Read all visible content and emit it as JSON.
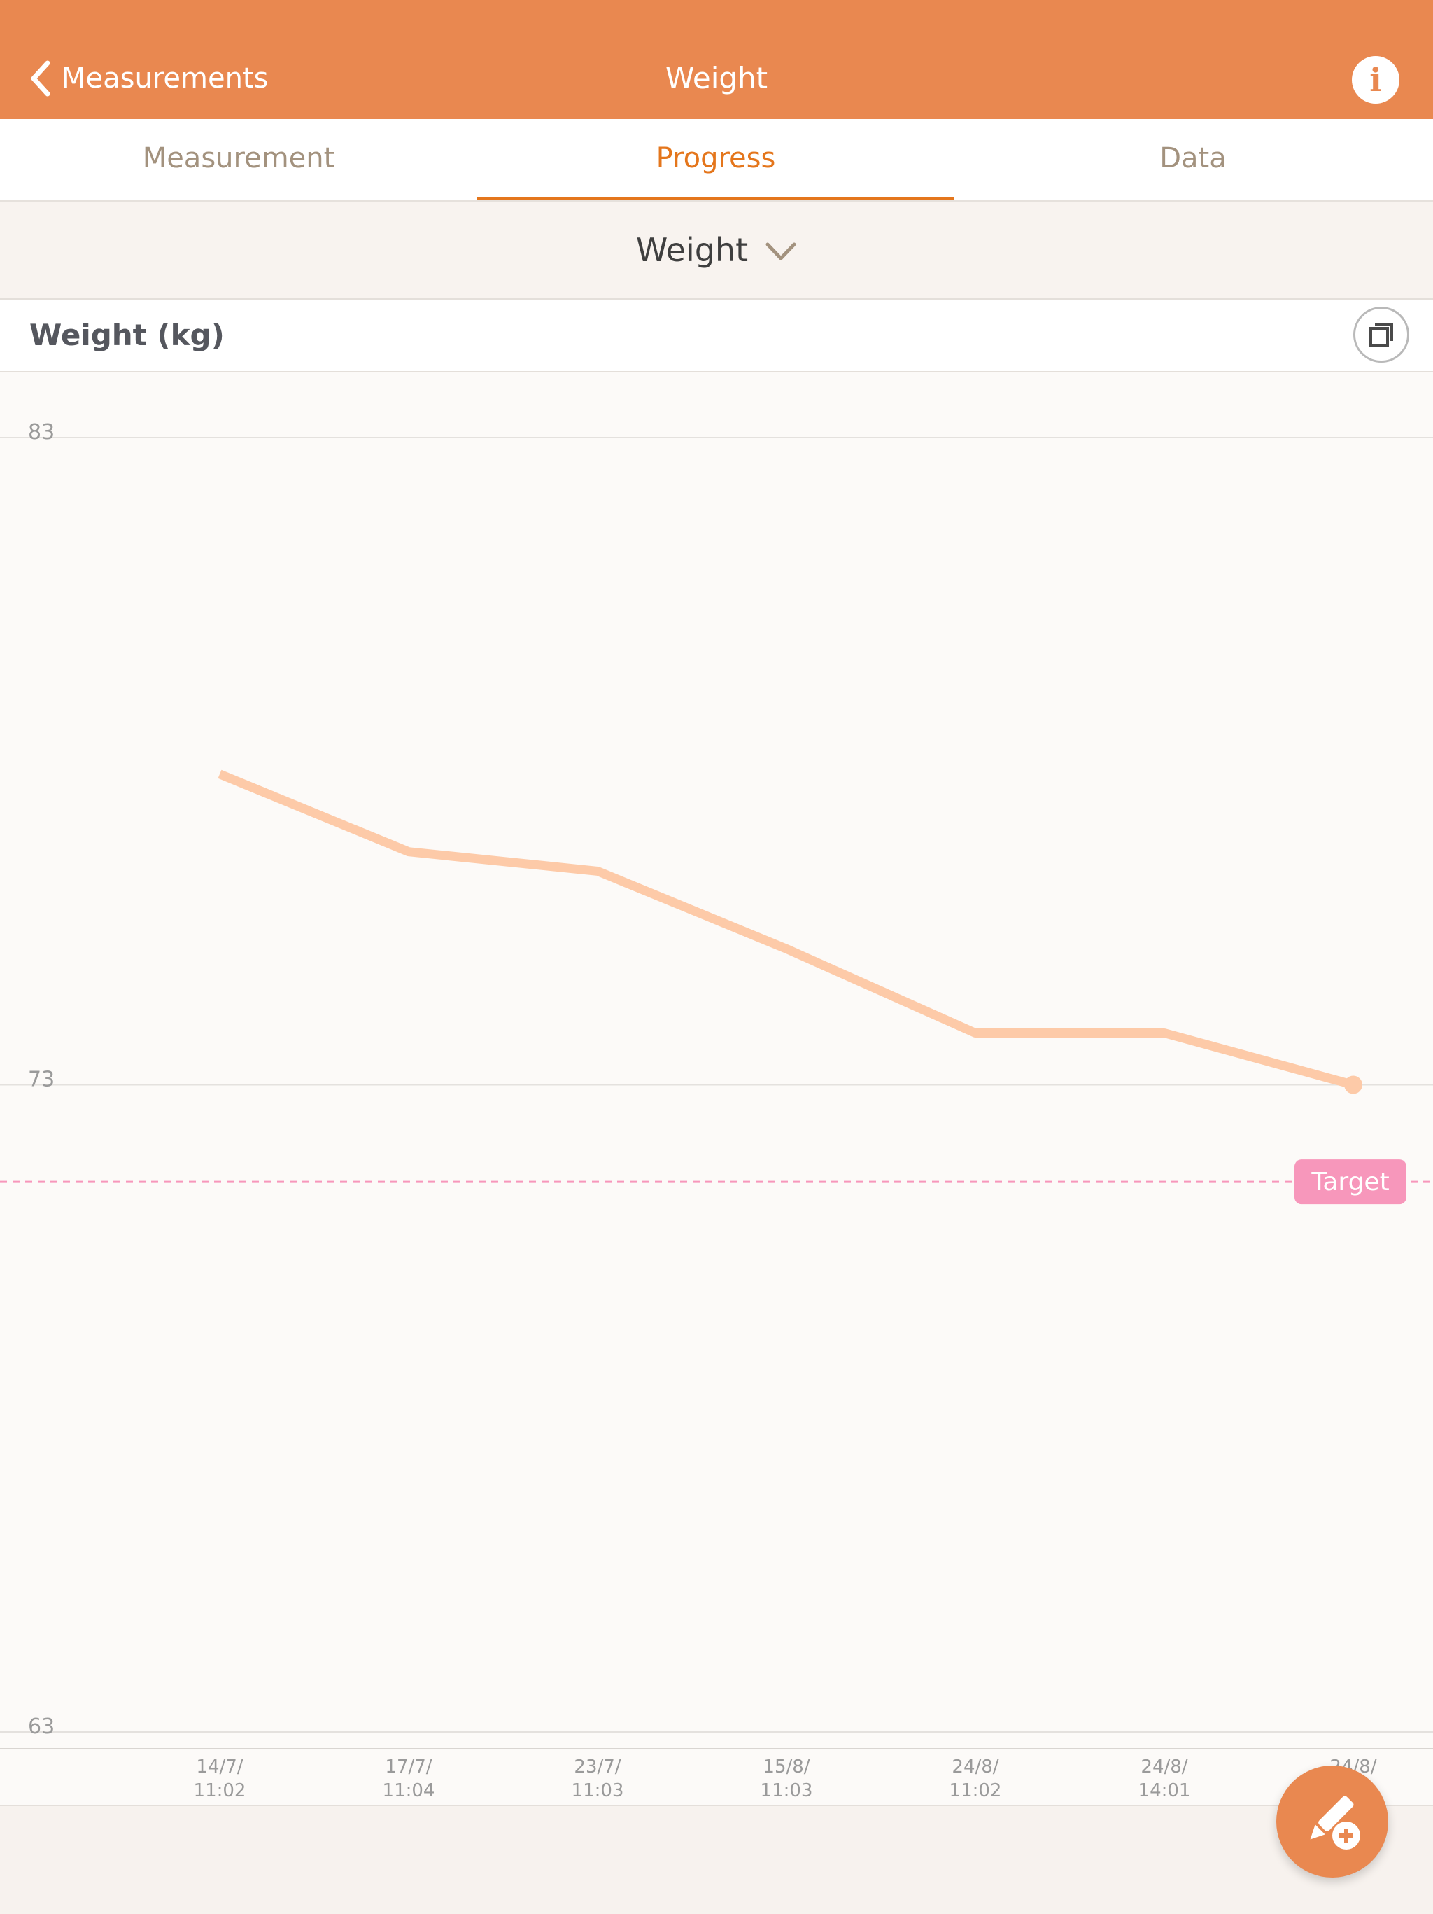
{
  "navbar": {
    "back_label": "Measurements",
    "title": "Weight",
    "info_glyph": "i",
    "back_icon": "chevron-left-icon",
    "info_icon": "info-icon"
  },
  "tabs": [
    {
      "label": "Measurement",
      "active": false
    },
    {
      "label": "Progress",
      "active": true
    },
    {
      "label": "Data",
      "active": false
    }
  ],
  "selector": {
    "value": "Weight",
    "icon": "chevron-down-icon"
  },
  "chart_header": {
    "title": "Weight (kg)",
    "expand_icon": "expand-icon"
  },
  "colors": {
    "accent": "#e98850",
    "tab_active": "#e4761c",
    "line": "#fdcaa8",
    "target": "#f797bb",
    "grid": "#e4e1de",
    "tick_text": "#9a9a9a"
  },
  "chart_data": {
    "type": "line",
    "ylabel": "Weight (kg)",
    "ylim": [
      63,
      83
    ],
    "yticks": [
      83,
      73,
      63
    ],
    "categories": [
      "14/7/\n11:02",
      "17/7/\n11:04",
      "23/7/\n11:03",
      "15/8/\n11:03",
      "24/8/\n11:02",
      "24/8/\n14:01",
      "24/8/\n"
    ],
    "series": [
      {
        "values": [
          77.8,
          76.6,
          76.3,
          75.1,
          73.8,
          73.8,
          73.0
        ]
      }
    ],
    "target": {
      "label": "Target",
      "value": 71.5
    },
    "grid": true
  },
  "fab": {
    "icon": "edit-add-icon"
  }
}
